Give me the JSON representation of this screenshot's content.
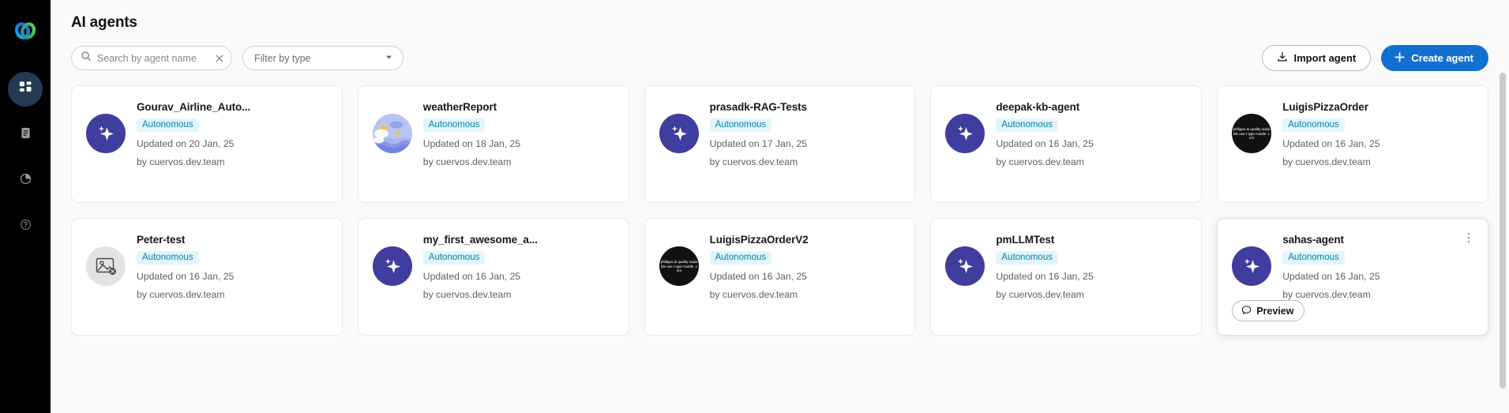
{
  "sidebar": {
    "logo": {
      "name": "webex-logo",
      "colors": [
        "#15c2e8",
        "#2f6fe0",
        "#57d06a"
      ]
    },
    "items": [
      {
        "name": "sidebar-item-agents",
        "icon": "grid-dashboard-icon",
        "active": true
      },
      {
        "name": "sidebar-item-documents",
        "icon": "document-icon",
        "active": false
      },
      {
        "name": "sidebar-item-analytics",
        "icon": "pie-chart-icon",
        "active": false
      },
      {
        "name": "sidebar-item-help",
        "icon": "help-circle-icon",
        "active": false
      }
    ]
  },
  "header": {
    "title": "AI agents"
  },
  "search": {
    "placeholder": "Search by agent name",
    "value": "",
    "icon": "search-icon",
    "clear_icon": "close-icon"
  },
  "filter": {
    "placeholder": "Filter by type",
    "value": "",
    "chevron_icon": "chevron-down-icon"
  },
  "actions": {
    "import_label": "Import agent",
    "import_icon": "download-icon",
    "create_label": "Create agent",
    "create_icon": "plus-icon",
    "primary_color": "#1170cf"
  },
  "badge_colors": {
    "background": "#e0f6fd",
    "text": "#0d7f9e"
  },
  "cards": [
    {
      "name": "Gourav_Airline_Auto...",
      "badge": "Autonomous",
      "updated": "Updated on 20 Jan, 25",
      "author": "by cuervos.dev.team",
      "avatar": "sparkle",
      "hovered": false
    },
    {
      "name": "weatherReport",
      "badge": "Autonomous",
      "updated": "Updated on 18 Jan, 25",
      "author": "by cuervos.dev.team",
      "avatar": "weather",
      "hovered": false
    },
    {
      "name": "prasadk-RAG-Tests",
      "badge": "Autonomous",
      "updated": "Updated on 17 Jan, 25",
      "author": "by cuervos.dev.team",
      "avatar": "sparkle",
      "hovered": false
    },
    {
      "name": "deepak-kb-agent",
      "badge": "Autonomous",
      "updated": "Updated on 16 Jan, 25",
      "author": "by cuervos.dev.team",
      "avatar": "sparkle",
      "hovered": false
    },
    {
      "name": "LuigisPizzaOrder",
      "badge": "Autonomous",
      "updated": "Updated on 16 Jan, 25",
      "author": "by cuervos.dev.team",
      "avatar": "dark-text",
      "hovered": false
    },
    {
      "name": "Peter-test",
      "badge": "Autonomous",
      "updated": "Updated on 16 Jan, 25",
      "author": "by cuervos.dev.team",
      "avatar": "broken-image",
      "hovered": false
    },
    {
      "name": "my_first_awesome_a...",
      "badge": "Autonomous",
      "updated": "Updated on 16 Jan, 25",
      "author": "by cuervos.dev.team",
      "avatar": "sparkle",
      "hovered": false
    },
    {
      "name": "LuigisPizzaOrderV2",
      "badge": "Autonomous",
      "updated": "Updated on 16 Jan, 25",
      "author": "by cuervos.dev.team",
      "avatar": "dark-text",
      "hovered": false
    },
    {
      "name": "pmLLMTest",
      "badge": "Autonomous",
      "updated": "Updated on 16 Jan, 25",
      "author": "by cuervos.dev.team",
      "avatar": "sparkle",
      "hovered": false
    },
    {
      "name": "sahas-agent",
      "badge": "Autonomous",
      "updated": "Updated on 16 Jan, 25",
      "author": "by cuervos.dev.team",
      "avatar": "sparkle",
      "hovered": true,
      "preview_label": "Preview",
      "preview_icon": "chat-bubble-icon",
      "kebab_icon": "more-vertical-icon"
    }
  ]
}
